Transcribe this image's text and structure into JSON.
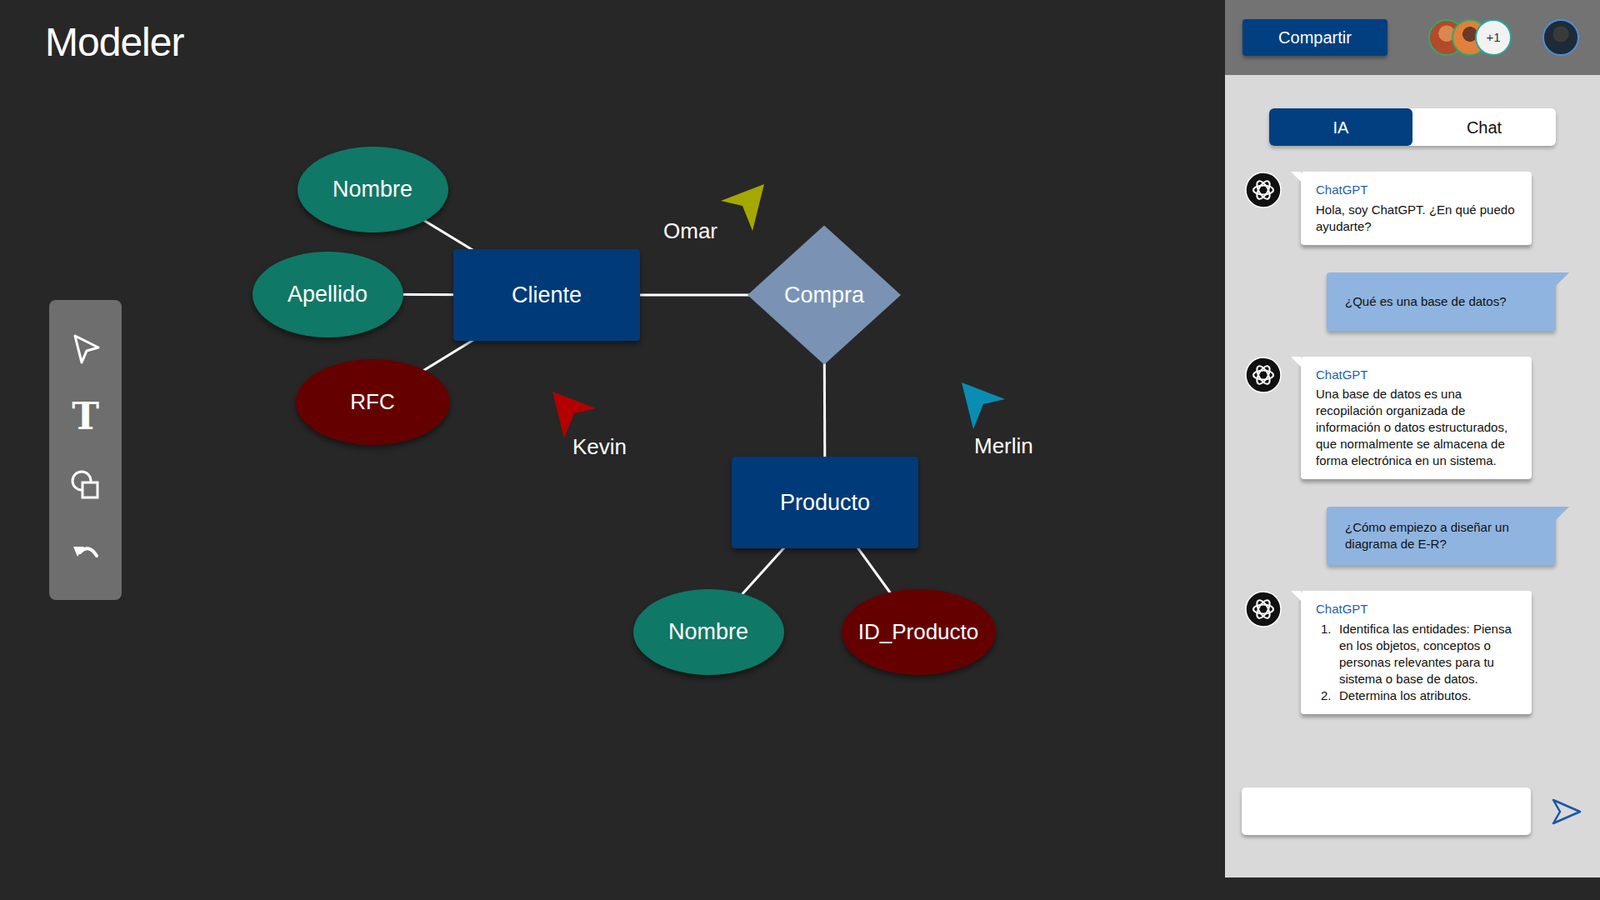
{
  "app": {
    "title": "Modeler"
  },
  "toolbar": {
    "tools": [
      {
        "kind": "select"
      },
      {
        "kind": "text",
        "glyph": "T"
      },
      {
        "kind": "shapes"
      },
      {
        "kind": "undo"
      }
    ]
  },
  "diagram": {
    "nodes": [
      {
        "label": "Nombre",
        "kind": "attribute"
      },
      {
        "label": "Apellido",
        "kind": "attribute"
      },
      {
        "label": "RFC",
        "kind": "key-attribute"
      },
      {
        "label": "Cliente",
        "kind": "entity"
      },
      {
        "label": "Compra",
        "kind": "relationship"
      },
      {
        "label": "Producto",
        "kind": "entity"
      },
      {
        "label": "Nombre",
        "kind": "attribute"
      },
      {
        "label": "ID_Producto",
        "kind": "key-attribute"
      }
    ],
    "edges": [
      {
        "from": 0,
        "to": 3
      },
      {
        "from": 1,
        "to": 3
      },
      {
        "from": 2,
        "to": 3
      },
      {
        "from": 3,
        "to": 4
      },
      {
        "from": 4,
        "to": 5
      },
      {
        "from": 5,
        "to": 6
      },
      {
        "from": 5,
        "to": 7
      }
    ]
  },
  "cursors": [
    {
      "name": "Omar",
      "color": "#a4a800"
    },
    {
      "name": "Kevin",
      "color": "#b30000"
    },
    {
      "name": "Merlin",
      "color": "#0a8db3"
    }
  ],
  "header": {
    "share_button": "Compartir",
    "collaborators_extra": "+1"
  },
  "tabs": [
    {
      "label": "IA",
      "selected": true
    },
    {
      "label": "Chat",
      "selected": false
    }
  ],
  "messages": [
    {
      "kind": "assistant",
      "sender": "ChatGPT",
      "text": "Hola, soy ChatGPT. ¿En qué puedo ayudarte?"
    },
    {
      "kind": "user",
      "text": "¿Qué es una base de datos?"
    },
    {
      "kind": "assistant",
      "sender": "ChatGPT",
      "text": "Una base de datos es una recopilación organizada de información o datos estructurados, que normalmente se almacena de forma electrónica en un sistema."
    },
    {
      "kind": "user",
      "text": "¿Cómo empiezo a diseñar un diagrama de E-R?"
    },
    {
      "kind": "assistant",
      "sender": "ChatGPT",
      "list": [
        {
          "marker": "1.",
          "text": "Identifica las entidades: Piensa en los objetos, conceptos o personas relevantes para tu sistema o base de datos."
        },
        {
          "marker": "2.",
          "text": "Determina los atributos."
        }
      ]
    }
  ]
}
